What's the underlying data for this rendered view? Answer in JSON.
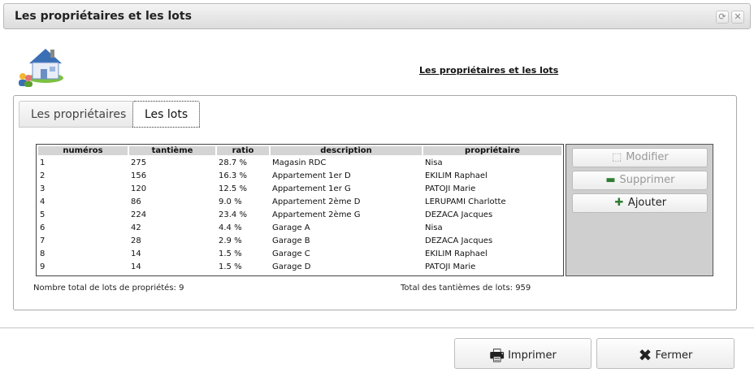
{
  "window": {
    "title": "Les propriétaires et les lots"
  },
  "header": {
    "heading": "Les propriétaires et les lots",
    "logo_icon": "house-owners-icon"
  },
  "tabs": [
    {
      "label": "Les propriétaires",
      "active": false
    },
    {
      "label": "Les lots",
      "active": true
    }
  ],
  "table": {
    "columns": [
      "numéros",
      "tantième",
      "ratio",
      "description",
      "propriétaire"
    ],
    "rows": [
      [
        "1",
        "275",
        "28.7 %",
        "Magasin RDC",
        "Nisa"
      ],
      [
        "2",
        "156",
        "16.3 %",
        "Appartement 1er D",
        "EKILIM Raphael"
      ],
      [
        "3",
        "120",
        "12.5 %",
        "Appartement 1er G",
        "PATOJI Marie"
      ],
      [
        "4",
        "86",
        "9.0 %",
        "Appartement 2ème D",
        "LERUPAMI Charlotte"
      ],
      [
        "5",
        "224",
        "23.4 %",
        "Appartement 2ème G",
        "DEZACA Jacques"
      ],
      [
        "6",
        "42",
        "4.4 %",
        "Garage A",
        "Nisa"
      ],
      [
        "7",
        "28",
        "2.9 %",
        "Garage B",
        "DEZACA Jacques"
      ],
      [
        "8",
        "14",
        "1.5 %",
        "Garage C",
        "EKILIM Raphael"
      ],
      [
        "9",
        "14",
        "1.5 %",
        "Garage D",
        "PATOJI Marie"
      ]
    ]
  },
  "actions": {
    "modify_label": "Modifier",
    "delete_label": "Supprimer",
    "add_label": "Ajouter"
  },
  "summary": {
    "total_lots": "Nombre total de lots de propriétés: 9",
    "total_tantiemes": "Total des tantièmes de lots: 959"
  },
  "footer": {
    "print_label": "Imprimer",
    "close_label": "Fermer"
  },
  "colors": {
    "accent": "#2e7d32",
    "header_bg": "#d4d4d4",
    "side_panel_bg": "#cfcfcf"
  }
}
